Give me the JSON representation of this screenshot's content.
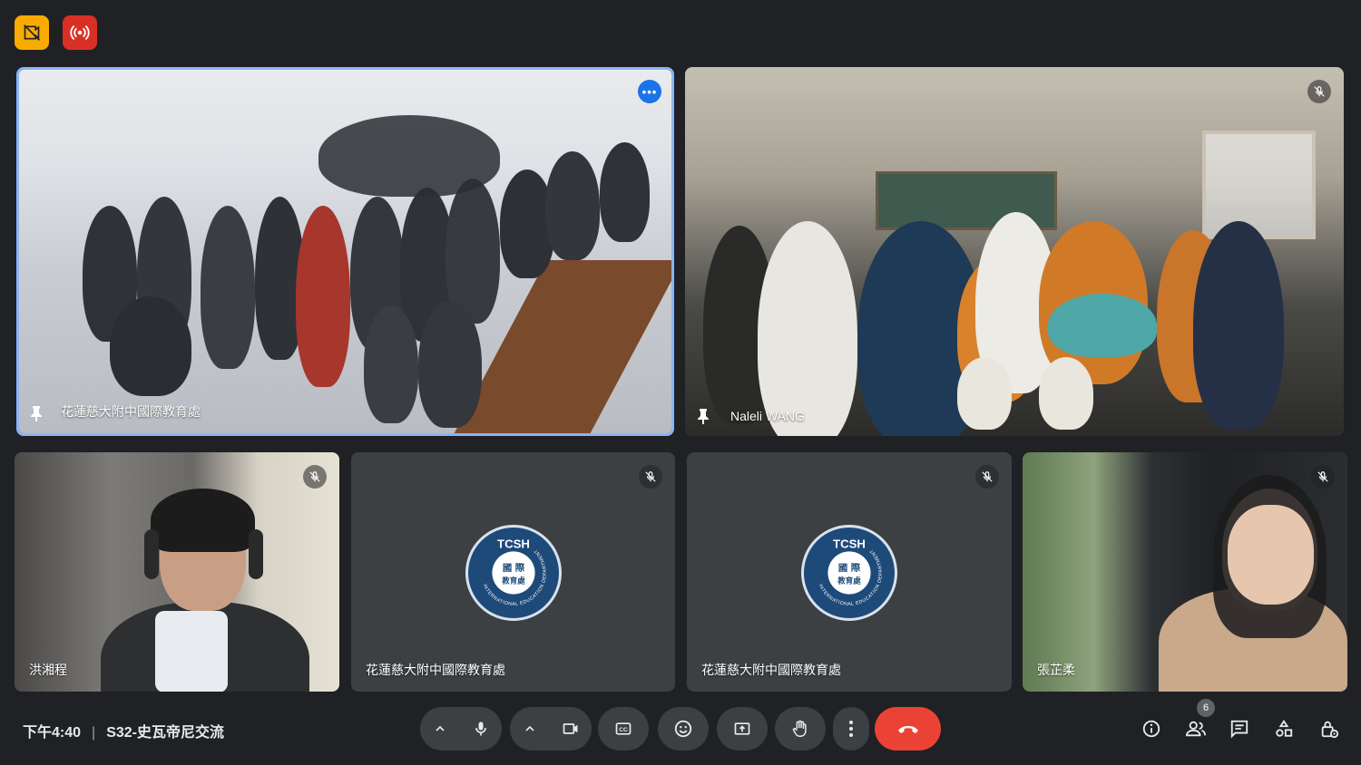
{
  "top_icons": [
    {
      "name": "no-video-icon",
      "color": "#f9ab00"
    },
    {
      "name": "live-broadcast-icon",
      "color": "#d93025"
    }
  ],
  "tiles": [
    {
      "name": "花蓮慈大附中國際教育處",
      "pinned": true,
      "active_speaker": true,
      "has_more_options": true
    },
    {
      "name": "Naleli WANG",
      "pinned": true,
      "muted": true
    },
    {
      "name": "洪湘程",
      "muted": true
    },
    {
      "name": "花蓮慈大附中國際教育處",
      "muted": true,
      "avatar": "tcsh-logo"
    },
    {
      "name": "花蓮慈大附中國際教育處",
      "muted": true,
      "avatar": "tcsh-logo"
    },
    {
      "name": "張芷柔",
      "muted": true
    }
  ],
  "logo": {
    "top_text": "TCSH",
    "center_line1": "國 際",
    "center_line2": "教育處",
    "ring_text": "INTERNATIONAL EDUCATION DEPARTMENT"
  },
  "meeting": {
    "time": "下午4:40",
    "separator": "|",
    "title": "S32-史瓦帝尼交流"
  },
  "controls": {
    "participant_count": "6"
  },
  "colors": {
    "background": "#202124",
    "control": "#3c4043",
    "hangup": "#ea4335",
    "active_border": "#8ab4f8"
  }
}
